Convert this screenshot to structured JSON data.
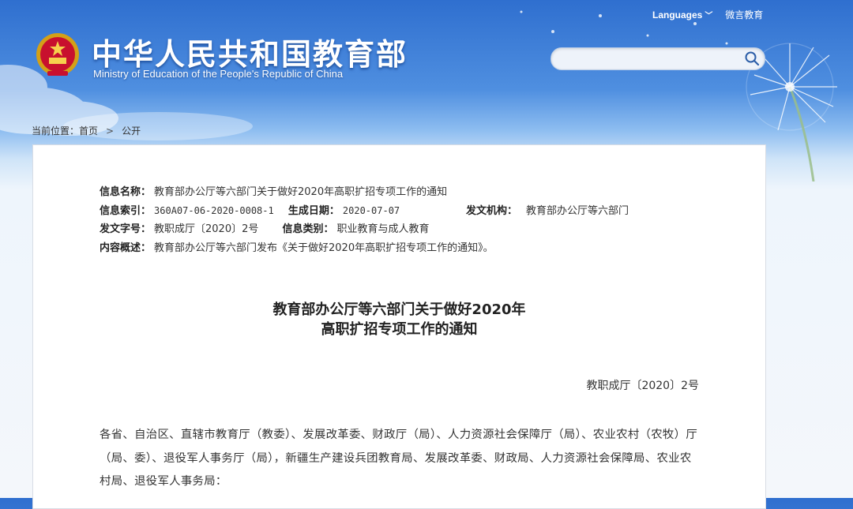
{
  "header": {
    "title_cn": "中华人民共和国教育部",
    "title_en": "Ministry of Education of the People's Republic of China",
    "languages_label": "Languages",
    "weibo_label": "微言教育"
  },
  "search": {
    "placeholder": "",
    "value": ""
  },
  "breadcrumb": {
    "prefix": "当前位置：",
    "home": "首页",
    "current": "公开"
  },
  "meta": {
    "name_label": "信息名称：",
    "name_value": "教育部办公厅等六部门关于做好2020年高职扩招专项工作的通知",
    "index_label": "信息索引：",
    "index_value": "360A07-06-2020-0008-1",
    "date_label": "生成日期：",
    "date_value": "2020-07-07",
    "org_label": "发文机构：",
    "org_value": "教育部办公厅等六部门",
    "docno_label": "发文字号：",
    "docno_value": "教职成厅〔2020〕2号",
    "category_label": "信息类别：",
    "category_value": "职业教育与成人教育",
    "summary_label": "内容概述：",
    "summary_value": "教育部办公厅等六部门发布《关于做好2020年高职扩招专项工作的通知》。"
  },
  "document": {
    "title_line1": "教育部办公厅等六部门关于做好2020年",
    "title_line2": "高职扩招专项工作的通知",
    "number": "教职成厅〔2020〕2号",
    "body": "各省、自治区、直辖市教育厅（教委）、发展改革委、财政厅（局）、人力资源社会保障厅（局）、农业农村（农牧）厅（局、委）、退役军人事务厅（局），新疆生产建设兵团教育局、发展改革委、财政局、人力资源社会保障局、农业农村局、退役军人事务局："
  },
  "colors": {
    "sky_top": "#2f6fcf",
    "panel_bg": "#ffffff",
    "text": "#333333"
  }
}
